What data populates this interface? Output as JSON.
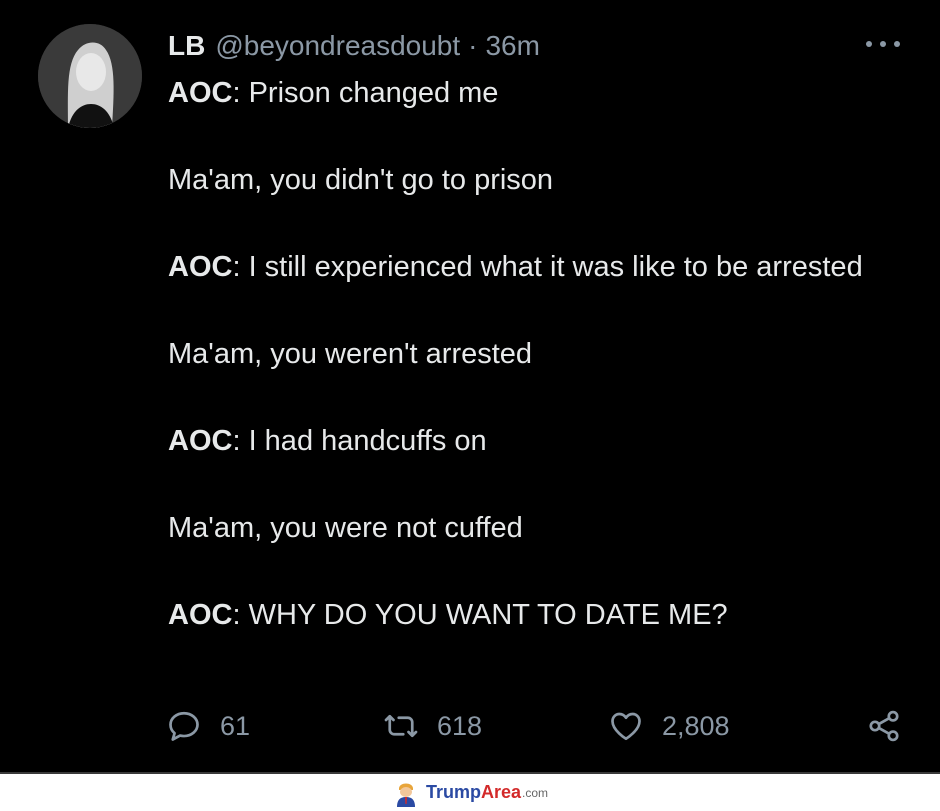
{
  "tweet": {
    "author_name": "LB",
    "handle": "@beyondreasdoubt",
    "separator": "·",
    "time": "36m",
    "lines": [
      {
        "speaker": "AOC",
        "text": ": Prison changed me"
      },
      {
        "speaker": "",
        "text": "Ma'am, you didn't go to prison"
      },
      {
        "speaker": "AOC",
        "text": ": I still experienced what it was like to be arrested"
      },
      {
        "speaker": "",
        "text": "Ma'am, you weren't arrested"
      },
      {
        "speaker": "AOC",
        "text": ": I had handcuffs on"
      },
      {
        "speaker": "",
        "text": "Ma'am, you were not cuffed"
      },
      {
        "speaker": "AOC",
        "text": ": WHY DO YOU WANT TO DATE ME?"
      }
    ],
    "replies": "61",
    "retweets": "618",
    "likes": "2,808"
  },
  "footer": {
    "brand_part1": "Trump",
    "brand_part2": "Area",
    "brand_suffix": ".com"
  },
  "icons": {
    "more": "more-dots-icon",
    "reply": "reply-icon",
    "retweet": "retweet-icon",
    "like": "heart-icon",
    "share": "share-icon"
  },
  "colors": {
    "background": "#000000",
    "text": "#e7e9ea",
    "muted": "#8b98a5"
  }
}
